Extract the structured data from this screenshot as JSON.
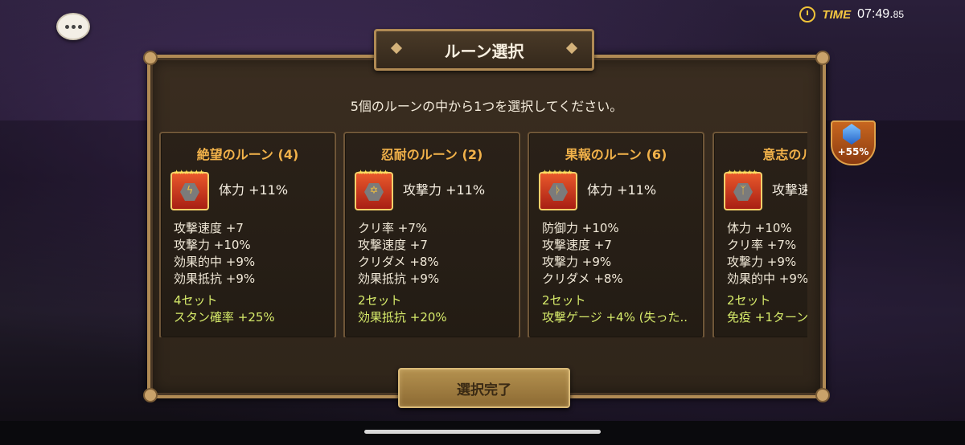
{
  "hud": {
    "time_label": "TIME",
    "time_value": "07:49.",
    "time_fraction": "85"
  },
  "dialog": {
    "title": "ルーン選択",
    "instruction": "5個のルーンの中から1つを選択してください。",
    "confirm_label": "選択完了"
  },
  "side_badge": {
    "percent": "+55%"
  },
  "cards": [
    {
      "name": "絶望のルーン (4)",
      "main_stat": "体力 +11%",
      "sub_stats": [
        "攻撃速度 +7",
        "攻撃力 +10%",
        "効果的中 +9%",
        "効果抵抗 +9%"
      ],
      "set_title": "4セット",
      "set_effect": "スタン確率 +25%"
    },
    {
      "name": "忍耐のルーン (2)",
      "main_stat": "攻撃力 +11%",
      "sub_stats": [
        "クリ率 +7%",
        "攻撃速度 +7",
        "クリダメ +8%",
        "効果抵抗 +9%"
      ],
      "set_title": "2セット",
      "set_effect": "効果抵抗 +20%"
    },
    {
      "name": "果報のルーン (6)",
      "main_stat": "体力 +11%",
      "sub_stats": [
        "防御力 +10%",
        "攻撃速度 +7",
        "攻撃力 +9%",
        "クリダメ +8%"
      ],
      "set_title": "2セット",
      "set_effect": "攻撃ゲージ +4% (失った.."
    },
    {
      "name": "意志のルーン",
      "main_stat": "攻撃速",
      "sub_stats": [
        "体力 +10%",
        "クリ率 +7%",
        "攻撃力 +9%",
        "効果的中 +9%"
      ],
      "set_title": "2セット",
      "set_effect": "免疫 +1ターン"
    }
  ],
  "colors": {
    "rune_name": "#f2b24a",
    "set_text": "#d6ea6a",
    "frame_gold": "#b08a54"
  }
}
